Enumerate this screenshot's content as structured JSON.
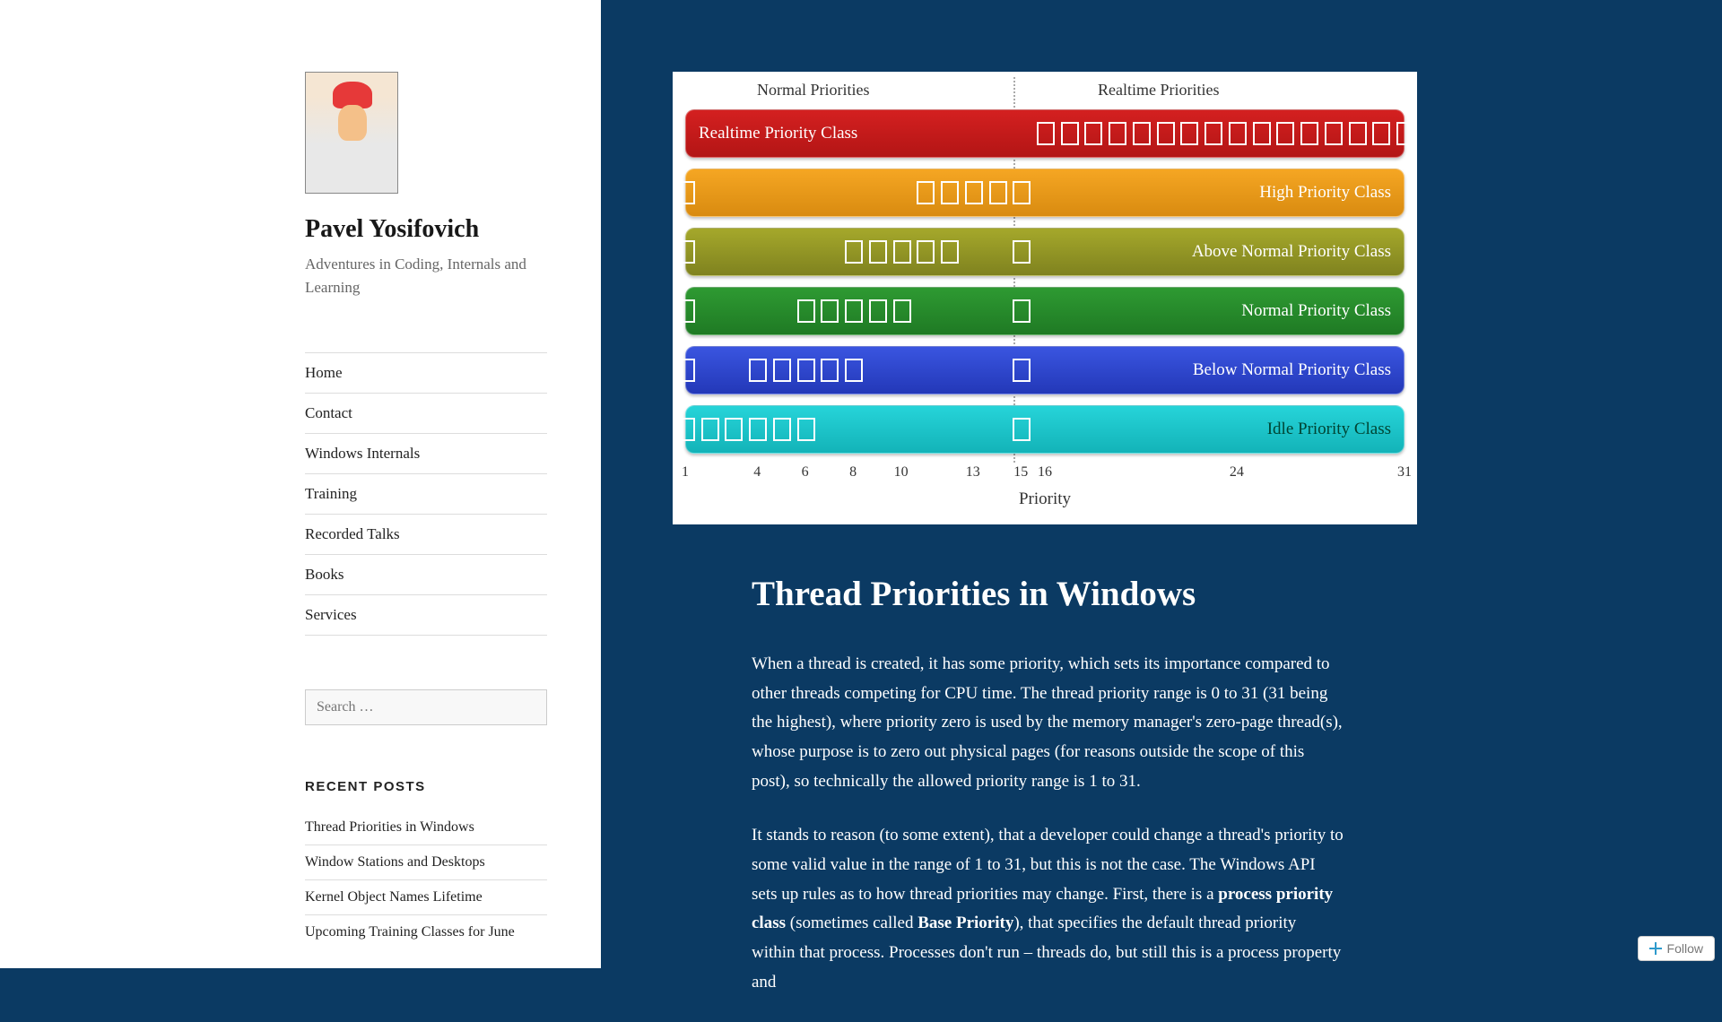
{
  "site": {
    "title": "Pavel Yosifovich",
    "tagline": "Adventures in Coding, Internals and Learning"
  },
  "nav": {
    "items": [
      {
        "label": "Home"
      },
      {
        "label": "Contact"
      },
      {
        "label": "Windows Internals"
      },
      {
        "label": "Training"
      },
      {
        "label": "Recorded Talks"
      },
      {
        "label": "Books"
      },
      {
        "label": "Services"
      }
    ]
  },
  "search": {
    "placeholder": "Search …"
  },
  "recent": {
    "title": "RECENT POSTS",
    "items": [
      {
        "label": "Thread Priorities in Windows"
      },
      {
        "label": "Window Stations and Desktops"
      },
      {
        "label": "Kernel Object Names Lifetime"
      },
      {
        "label": "Upcoming Training Classes for June"
      }
    ]
  },
  "diagram": {
    "header_left": "Normal Priorities",
    "header_right": "Realtime Priorities",
    "axis_label": "Priority",
    "axis_ticks": [
      "1",
      "4",
      "6",
      "8",
      "10",
      "13",
      "15",
      "16",
      "24",
      "31"
    ]
  },
  "chart_data": {
    "type": "bar",
    "xlabel": "Priority",
    "ylabel": "",
    "xlim": [
      1,
      31
    ],
    "divider_at": 15.5,
    "axis_tick_values": [
      1,
      4,
      6,
      8,
      10,
      13,
      15,
      16,
      24,
      31
    ],
    "classes": [
      {
        "name": "Realtime Priority Class",
        "label_side": "left",
        "color": "#c81919",
        "marker_priorities": [
          16,
          17,
          18,
          19,
          20,
          21,
          22,
          23,
          24,
          25,
          26,
          27,
          28,
          29,
          30,
          31
        ]
      },
      {
        "name": "High Priority Class",
        "label_side": "right",
        "color": "#e8961a",
        "marker_priorities": [
          1,
          11,
          12,
          13,
          14,
          15
        ]
      },
      {
        "name": "Above Normal Priority Class",
        "label_side": "right",
        "color": "#939622",
        "marker_priorities": [
          1,
          8,
          9,
          10,
          11,
          12,
          15
        ]
      },
      {
        "name": "Normal Priority Class",
        "label_side": "right",
        "color": "#278c2b",
        "marker_priorities": [
          1,
          6,
          7,
          8,
          9,
          10,
          15
        ]
      },
      {
        "name": "Below Normal Priority Class",
        "label_side": "right",
        "color": "#2d45cc",
        "marker_priorities": [
          1,
          4,
          5,
          6,
          7,
          8,
          15
        ]
      },
      {
        "name": "Idle Priority Class",
        "label_side": "right",
        "color": "#1cc5ca",
        "marker_priorities": [
          1,
          2,
          3,
          4,
          5,
          6,
          15
        ]
      }
    ]
  },
  "article": {
    "title": "Thread Priorities in Windows",
    "p1_a": "When a thread is created, it has some priority, which sets its importance compared to other threads competing for CPU time. The thread priority range is 0 to 31 (31 being the highest), where priority zero is used by the memory manager's zero-page thread(s), whose purpose is to zero out physical pages (for reasons outside the scope of this post), so technically the allowed priority range is 1 to 31.",
    "p2_a": "It stands to reason (to some extent), that a developer could change a thread's priority to some valid value in the range of 1 to 31, but this is not the case. The Windows API sets up rules as to how thread priorities may change. First, there is a ",
    "p2_b": "process priority class",
    "p2_c": " (sometimes called ",
    "p2_d": "Base Priority",
    "p2_e": "), that specifies the default thread priority within that process. Processes don't run – threads do, but still this is a process property and"
  },
  "follow": {
    "label": "Follow"
  }
}
